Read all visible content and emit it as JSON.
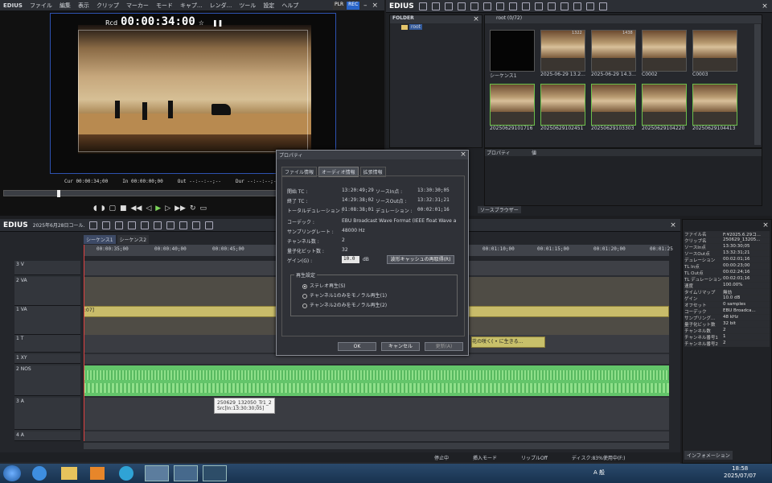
{
  "player": {
    "app": "EDIUS",
    "menu": [
      "ファイル",
      "編集",
      "表示",
      "クリップ",
      "マーカー",
      "モード",
      "キャプ...",
      "レンダ...",
      "ツール",
      "設定",
      "ヘルプ"
    ],
    "plr": "PLR",
    "rec": "REC",
    "rcd_label": "Rcd",
    "timecode": "00:00:34:00",
    "cur": "Cur 00:00:34;00",
    "in": "In 00:00:00;00",
    "out": "Out --:--:--;--",
    "dur": "Dur --:--:--;--",
    "stage_desc": "concert hall stage video"
  },
  "bin": {
    "app": "EDIUS",
    "folder_title": "FOLDER",
    "root_folder": "root",
    "root_title": "root (0/72)",
    "clips": [
      {
        "name": "シーケンス1",
        "badge": ""
      },
      {
        "name": "2025-06-29 13.2...",
        "badge": "1322"
      },
      {
        "name": "2025-06-29 14.3...",
        "badge": "1438"
      },
      {
        "name": "C0002",
        "badge": ""
      },
      {
        "name": "C0003",
        "badge": ""
      },
      {
        "name": "20250629101716",
        "badge": ""
      },
      {
        "name": "20250629102451",
        "badge": ""
      },
      {
        "name": "20250629103303",
        "badge": ""
      },
      {
        "name": "20250629104220",
        "badge": ""
      },
      {
        "name": "20250629104413",
        "badge": ""
      }
    ],
    "prop_label": "プロパティ",
    "val_label": "値",
    "source_browser": "ソースブラウザー"
  },
  "timeline": {
    "app": "EDIUS",
    "title": "2025年6月28日コール...",
    "tabs": [
      "シーケンス1",
      "シーケンス2"
    ],
    "ruler": [
      "00:00:35;00",
      "00:00:40;00",
      "00:00:45;00",
      "00:01:10;00",
      "00:01:15;00",
      "00:01:20;00",
      "00:01:25"
    ],
    "tracks": [
      {
        "id": "3 V",
        "type": "V"
      },
      {
        "id": "2 VA",
        "type": "VA"
      },
      {
        "id": "1 VA",
        "type": "VA"
      },
      {
        "id": "1 T",
        "type": "T"
      },
      {
        "id": "1 XY",
        "type": "A"
      },
      {
        "id": "2 NOS",
        "type": "A"
      },
      {
        "id": "3 A",
        "type": "A"
      },
      {
        "id": "4 A",
        "type": "A"
      }
    ],
    "clip_label": ":07]",
    "title_clip_label": "花の咲く( • に生きる...",
    "tooltip_line1": "250629_132050_Tr1_2",
    "tooltip_line2": "Src[In:13:30:30;05]"
  },
  "dialog": {
    "title": "プロパティ",
    "tabs": [
      "ファイル情報",
      "オーディオ情報",
      "拡張情報"
    ],
    "rows": [
      {
        "k": "開始 TC :",
        "v": "13:20:49;29",
        "k2": "ソースIn点 :",
        "v2": "13:30:30;05"
      },
      {
        "k": "終了 TC :",
        "v": "14:29:38;02",
        "k2": "ソースOut点 :",
        "v2": "13:32:31;21"
      },
      {
        "k": "トータルデュレーション :",
        "v": "01:08:38;01",
        "k2": "デュレーション :",
        "v2": "00:02:01;16"
      }
    ],
    "codec_label": "コーデック :",
    "codec_value": "EBU Broadcast Wave Format (IEEE float Wave a",
    "sr_label": "サンプリングレート :",
    "sr_value": "48000 Hz",
    "ch_label": "チャンネル数 :",
    "ch_value": "2",
    "qb_label": "量子化ビット数 :",
    "qb_value": "32",
    "gain_label": "ゲイン(G) :",
    "gain_value": "10.0",
    "gain_unit": "dB",
    "cache_button": "波形キャッシュの再取得(R)",
    "play_group": "再生設定",
    "radios": [
      "ステレオ再生(S)",
      "チャンネル1のみをモノラル再生(1)",
      "チャンネル2のみをモノラル再生(2)"
    ],
    "ok": "OK",
    "cancel": "キャンセル",
    "apply": "更新(A)"
  },
  "info": {
    "rows": [
      {
        "k": "ファイル名",
        "v": "F:¥2025.6.29コ..."
      },
      {
        "k": "クリップ名",
        "v": "250629_13205..."
      },
      {
        "k": "ソースIn点",
        "v": "13:30:30;05"
      },
      {
        "k": "ソースOut点",
        "v": "13:32:31;21"
      },
      {
        "k": "デュレーション",
        "v": "00:02:01;16"
      },
      {
        "k": "TL In点",
        "v": "00:00:23;00"
      },
      {
        "k": "TL Out点",
        "v": "00:02:24;16"
      },
      {
        "k": "TL デュレーション",
        "v": "00:02:01;16"
      },
      {
        "k": "速度",
        "v": "100.00%"
      },
      {
        "k": "タイムリマップ",
        "v": "無効"
      },
      {
        "k": "ゲイン",
        "v": "10.0 dB"
      },
      {
        "k": "オフセット",
        "v": "0 samples"
      },
      {
        "k": "コーデック",
        "v": "EBU Broadca..."
      },
      {
        "k": "サンプリング...",
        "v": "48 kHz"
      },
      {
        "k": "量子化ビット数",
        "v": "32 bit"
      },
      {
        "k": "チャンネル数",
        "v": "2"
      },
      {
        "k": "チャンネル番号1",
        "v": "1"
      },
      {
        "k": "チャンネル番号2",
        "v": "2"
      }
    ],
    "tab": "インフォメーション"
  },
  "statusbar": {
    "stopped": "停止中",
    "insert_mode": "挿入モード",
    "ripple": "リップルOff",
    "disk": "ディスク:83%使用中(F:)"
  },
  "taskbar": {
    "lang": "A 般",
    "time": "18:58",
    "date": "2025/07/07"
  }
}
